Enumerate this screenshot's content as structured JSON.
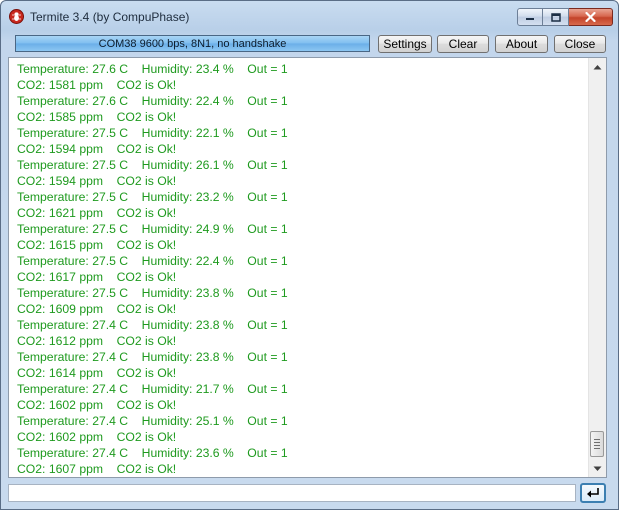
{
  "window": {
    "title": "Termite 3.4 (by CompuPhase)",
    "controls": {
      "minimize": "minimize-icon",
      "maximize": "maximize-icon",
      "close": "close-icon"
    }
  },
  "toolbar": {
    "status": "COM38 9600 bps, 8N1, no handshake",
    "settings_label": "Settings",
    "clear_label": "Clear",
    "about_label": "About",
    "close_label": "Close"
  },
  "terminal": {
    "text_color": "#1e9a1e",
    "lines": [
      "Temperature: 27.6 C    Humidity: 23.4 %    Out = 1",
      "CO2: 1581 ppm    CO2 is Ok!",
      "Temperature: 27.6 C    Humidity: 22.4 %    Out = 1",
      "CO2: 1585 ppm    CO2 is Ok!",
      "Temperature: 27.5 C    Humidity: 22.1 %    Out = 1",
      "CO2: 1594 ppm    CO2 is Ok!",
      "Temperature: 27.5 C    Humidity: 26.1 %    Out = 1",
      "CO2: 1594 ppm    CO2 is Ok!",
      "Temperature: 27.5 C    Humidity: 23.2 %    Out = 1",
      "CO2: 1621 ppm    CO2 is Ok!",
      "Temperature: 27.5 C    Humidity: 24.9 %    Out = 1",
      "CO2: 1615 ppm    CO2 is Ok!",
      "Temperature: 27.5 C    Humidity: 22.4 %    Out = 1",
      "CO2: 1617 ppm    CO2 is Ok!",
      "Temperature: 27.5 C    Humidity: 23.8 %    Out = 1",
      "CO2: 1609 ppm    CO2 is Ok!",
      "Temperature: 27.4 C    Humidity: 23.8 %    Out = 1",
      "CO2: 1612 ppm    CO2 is Ok!",
      "Temperature: 27.4 C    Humidity: 23.8 %    Out = 1",
      "CO2: 1614 ppm    CO2 is Ok!",
      "Temperature: 27.4 C    Humidity: 21.7 %    Out = 1",
      "CO2: 1602 ppm    CO2 is Ok!",
      "Temperature: 27.4 C    Humidity: 25.1 %    Out = 1",
      "CO2: 1602 ppm    CO2 is Ok!",
      "Temperature: 27.4 C    Humidity: 23.6 %    Out = 1",
      "CO2: 1607 ppm    CO2 is Ok!"
    ]
  },
  "scrollbar": {
    "up": "scroll-up-arrow-icon",
    "down": "scroll-down-arrow-icon",
    "position": 1.0
  },
  "input": {
    "value": "",
    "send": "enter-return-icon"
  }
}
